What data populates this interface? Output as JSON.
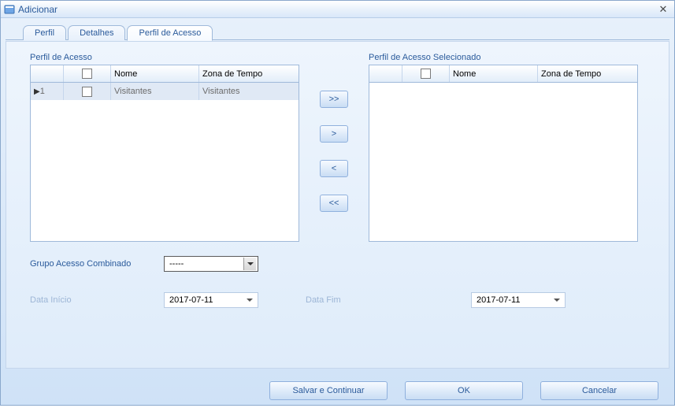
{
  "window": {
    "title": "Adicionar"
  },
  "tabs": {
    "perfil": "Perfil",
    "detalhes": "Detalhes",
    "perfil_acesso": "Perfil de Acesso"
  },
  "left_grid": {
    "title": "Perfil de Acesso",
    "headers": {
      "nome": "Nome",
      "zona": "Zona de Tempo"
    },
    "rows": [
      {
        "idx": "1",
        "nome": "Visitantes",
        "zona": "Visitantes"
      }
    ]
  },
  "right_grid": {
    "title": "Perfil de Acesso Selecionado",
    "headers": {
      "nome": "Nome",
      "zona": "Zona de Tempo"
    }
  },
  "transfer": {
    "add_all": ">>",
    "add_one": ">",
    "remove_one": "<",
    "remove_all": "<<"
  },
  "form": {
    "grupo_label": "Grupo Acesso Combinado",
    "grupo_value": "-----",
    "data_inicio_label": "Data Início",
    "data_inicio_value": "2017-07-11",
    "data_fim_label": "Data Fim",
    "data_fim_value": "2017-07-11"
  },
  "footer": {
    "save_continue": "Salvar e Continuar",
    "ok": "OK",
    "cancel": "Cancelar"
  }
}
